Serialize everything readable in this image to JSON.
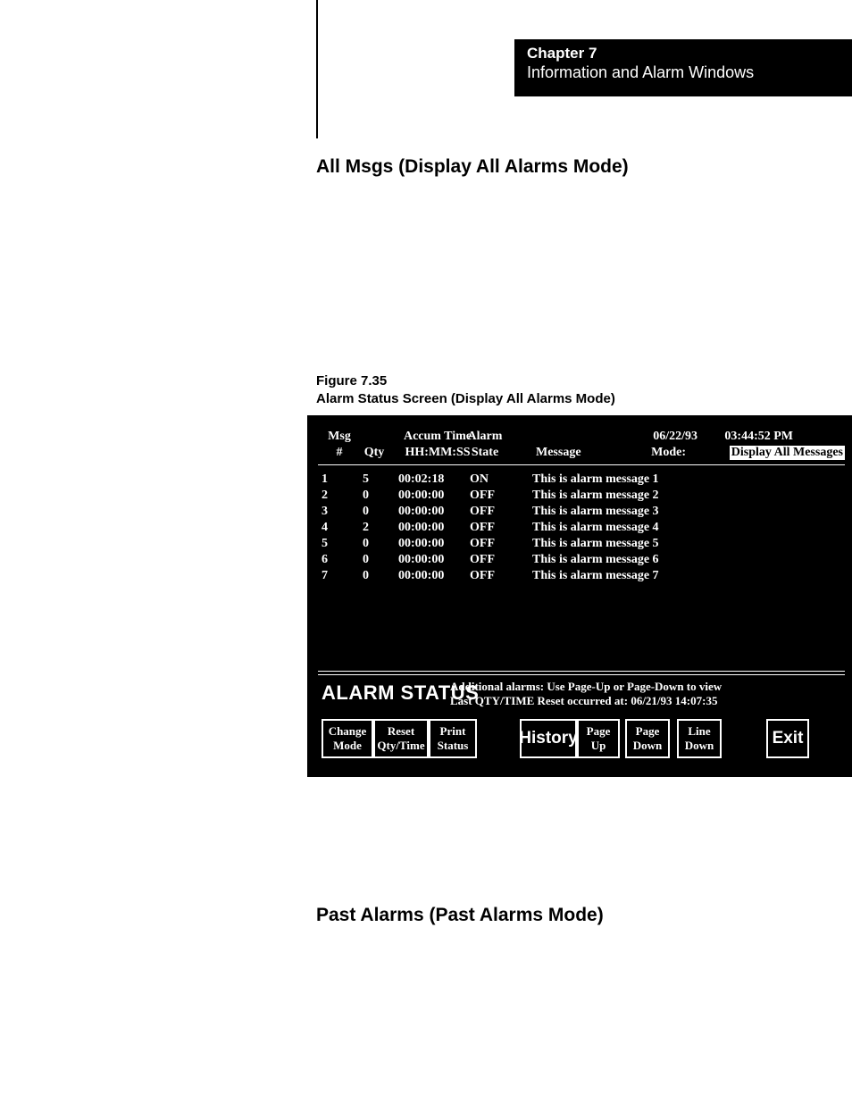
{
  "header": {
    "chapter": "Chapter 7",
    "subtitle": "Information and Alarm Windows"
  },
  "section1_title": "All Msgs (Display All Alarms Mode)",
  "figure": {
    "number": "Figure 7.35",
    "caption": "Alarm Status Screen (Display All Alarms Mode)"
  },
  "terminal": {
    "columns": {
      "msg_l1": "Msg",
      "msg_l2": "#",
      "qty": "Qty",
      "accum_l1": "Accum Time",
      "accum_l2": "HH:MM:SS",
      "state_l1": "Alarm",
      "state_l2": "State",
      "message": "Message"
    },
    "date": "06/22/93",
    "time": "03:44:52 PM",
    "mode_label": "Mode:",
    "mode_value": "Display All Messages",
    "rows": [
      {
        "msg": "1",
        "qty": "5",
        "time": "00:02:18",
        "state": "ON",
        "text": "This is alarm message 1"
      },
      {
        "msg": "2",
        "qty": "0",
        "time": "00:00:00",
        "state": "OFF",
        "text": "This is alarm message 2"
      },
      {
        "msg": "3",
        "qty": "0",
        "time": "00:00:00",
        "state": "OFF",
        "text": "This is alarm message 3"
      },
      {
        "msg": "4",
        "qty": "2",
        "time": "00:00:00",
        "state": "OFF",
        "text": "This is alarm message 4"
      },
      {
        "msg": "5",
        "qty": "0",
        "time": "00:00:00",
        "state": "OFF",
        "text": "This is alarm message 5"
      },
      {
        "msg": "6",
        "qty": "0",
        "time": "00:00:00",
        "state": "OFF",
        "text": "This is alarm message 6"
      },
      {
        "msg": "7",
        "qty": "0",
        "time": "00:00:00",
        "state": "OFF",
        "text": "This is alarm message 7"
      }
    ],
    "status_title": "ALARM STATUS",
    "status_msg1": "Additional alarms:  Use Page-Up or Page-Down to view",
    "status_msg2": "Last QTY/TIME Reset occurred at:  06/21/93 14:07:35",
    "buttons": {
      "change_mode_l1": "Change",
      "change_mode_l2": "Mode",
      "reset_l1": "Reset",
      "reset_l2": "Qty/Time",
      "print_l1": "Print",
      "print_l2": "Status",
      "history": "History",
      "pageup_l1": "Page",
      "pageup_l2": "Up",
      "pagedown_l1": "Page",
      "pagedown_l2": "Down",
      "linedown_l1": "Line",
      "linedown_l2": "Down",
      "exit": "Exit"
    }
  },
  "section2_title": "Past Alarms (Past Alarms Mode)"
}
